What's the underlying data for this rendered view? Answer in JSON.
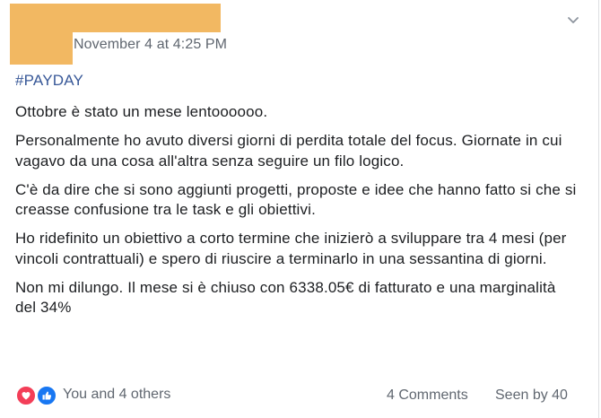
{
  "post": {
    "timestamp": "November 4 at 4:25 PM",
    "hashtag": "#PAYDAY",
    "paragraphs": [
      "Ottobre è stato un mese lentoooooo.",
      "Personalmente ho avuto diversi giorni di perdita totale del focus. Giornate in cui vagavo da una cosa all'altra senza seguire un filo logico.",
      "C'è da dire che si sono aggiunti progetti, proposte e idee che hanno fatto si che si creasse confusione tra le task e gli obiettivi.",
      "Ho ridefinito un obiettivo a corto termine che inizierò a sviluppare tra 4 mesi (per vincoli contrattuali) e spero di riuscire a terminarlo in una sessantina di giorni.",
      "Non mi dilungo. Il mese si è chiuso con 6338.05€ di fatturato e una marginalità del 34%"
    ],
    "footer": {
      "reactions_label": "You and 4 others",
      "comments": "4 Comments",
      "seen": "Seen by 40"
    }
  },
  "icons": {
    "menu": "chevron-down-icon",
    "reaction_love": "heart-icon",
    "reaction_like": "thumbs-up-icon"
  },
  "colors": {
    "redaction": "#f2b862",
    "link": "#385898",
    "muted": "#606770",
    "like_blue": "#1877f2",
    "love_red": "#f33e58"
  }
}
